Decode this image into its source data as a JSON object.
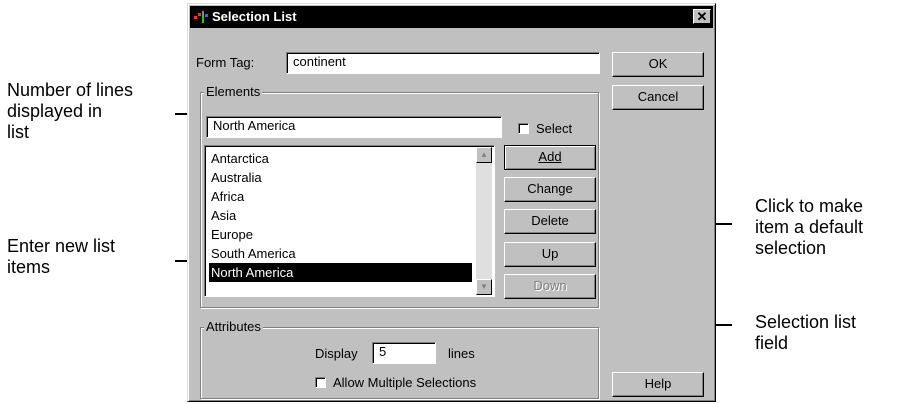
{
  "callouts": {
    "lines_in_list": "Number of lines\ndisplayed in\nlist",
    "new_items": "Enter new list\nitems",
    "default_selection": "Click to make\nitem a default\nselection",
    "selection_field": "Selection list\nfield"
  },
  "dialog": {
    "title": "Selection List",
    "close_glyph": "✕",
    "form_tag_label": "Form Tag:",
    "form_tag_value": "continent",
    "ok_label": "OK",
    "cancel_label": "Cancel",
    "help_label": "Help",
    "elements": {
      "group_label": "Elements",
      "new_item_value": "North America",
      "select_label": "Select",
      "items": [
        "Antarctica",
        "Australia",
        "Africa",
        "Asia",
        "Europe",
        "South America",
        "North America"
      ],
      "selected_item": "North America",
      "buttons": {
        "add": "Add",
        "change": "Change",
        "delete": "Delete",
        "up": "Up",
        "down": "Down"
      }
    },
    "attributes": {
      "group_label": "Attributes",
      "display_label": "Display",
      "display_value": "5",
      "lines_label": "lines",
      "allow_multiple_label": "Allow Multiple Selections"
    }
  },
  "icons": {
    "title_icon": "app-icon",
    "scroll_up": "scroll-up-arrow-icon",
    "scroll_down": "scroll-down-arrow-icon"
  },
  "colors": {
    "dialog_face": "#c0c0c0",
    "title_bar": "#000000",
    "selection_highlight": "#000000"
  }
}
